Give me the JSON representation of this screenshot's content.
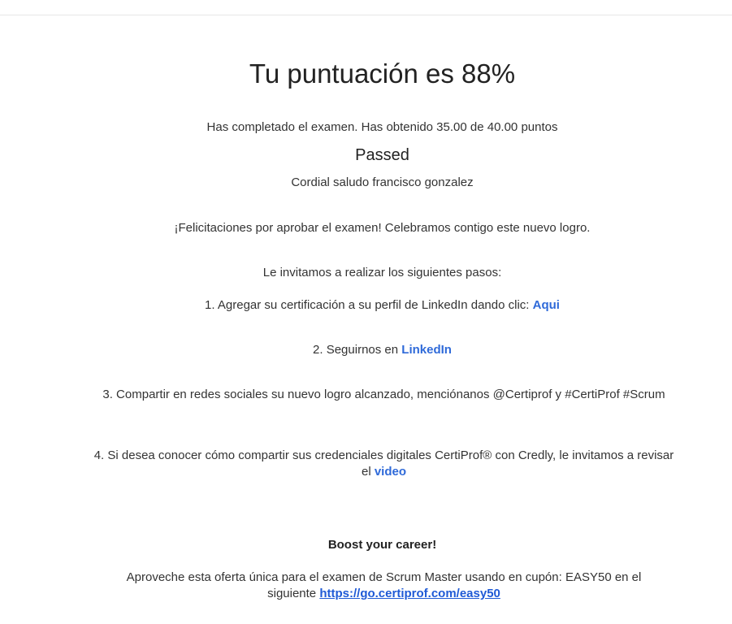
{
  "result": {
    "title": "Tu puntuación es 88%",
    "summary": "Has completado el examen. Has obtenido 35.00 de 40.00 puntos",
    "status": "Passed",
    "greeting": "Cordial saludo francisco gonzalez",
    "congrats": "¡Felicitaciones por aprobar el examen! Celebramos contigo este nuevo logro.",
    "invite": "Le invitamos a realizar los siguientes pasos:"
  },
  "steps": {
    "step1_text": "1. Agregar su certificación a su perfil de LinkedIn dando clic: ",
    "step1_link": "Aqui",
    "step2_text": "2. Seguirnos en ",
    "step2_link": "LinkedIn",
    "step3_text": "3. Compartir en redes sociales su nuevo logro alcanzado, menciónanos @Certiprof y #CertiProf #Scrum",
    "step4_text": "4. Si desea conocer cómo compartir sus credenciales digitales CertiProf® con Credly, le invitamos a revisar el ",
    "step4_link": "video"
  },
  "promo": {
    "heading": "Boost your career!",
    "text": "Aproveche esta oferta única para el examen de Scrum Master usando en cupón: EASY50 en el siguiente ",
    "link": "https://go.certiprof.com/easy50"
  },
  "colors": {
    "link": "#2f6ad9",
    "text": "#333333",
    "rule": "#e6e6e6"
  }
}
